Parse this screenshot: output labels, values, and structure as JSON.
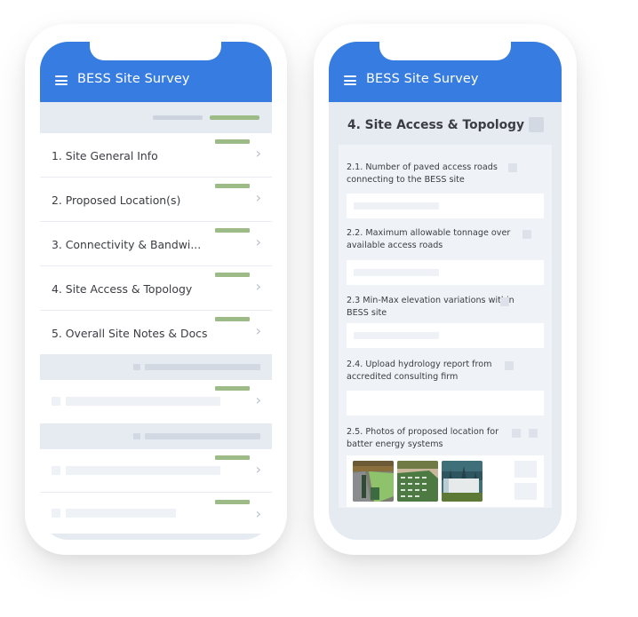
{
  "app": {
    "title": "BESS Site Survey"
  },
  "left_screen": {
    "sections": [
      {
        "label": "1. Site General Info",
        "status": "complete"
      },
      {
        "label": "2. Proposed Location(s)",
        "status": "complete"
      },
      {
        "label": "3. Connectivity & Bandwi...",
        "status": "complete"
      },
      {
        "label": "4. Site Access & Topology",
        "status": "complete"
      },
      {
        "label": "5. Overall Site Notes & Docs",
        "status": "complete"
      }
    ],
    "colors": {
      "header": "#377ce0",
      "status_complete": "#9dbb86"
    }
  },
  "right_screen": {
    "section_title": "4. Site Access & Topology",
    "questions": [
      {
        "label": "2.1. Number of paved access roads connecting to the BESS site",
        "type": "text"
      },
      {
        "label": "2.2. Maximum allowable tonnage over available access roads",
        "type": "text"
      },
      {
        "label": "2.3 Min-Max elevation variations within BESS site",
        "type": "text"
      },
      {
        "label": "2.4. Upload hydrology report from accredited consulting firm",
        "type": "file"
      },
      {
        "label": "2.5. Photos of proposed location for batter energy systems",
        "type": "photos"
      }
    ],
    "photos": [
      {
        "name": "battery-yard-photo-1",
        "subject": "green battery containers rows"
      },
      {
        "name": "battery-yard-photo-2",
        "subject": "aerial battery container grid"
      },
      {
        "name": "battery-yard-photo-3",
        "subject": "white battery enclosure with trees"
      }
    ]
  }
}
